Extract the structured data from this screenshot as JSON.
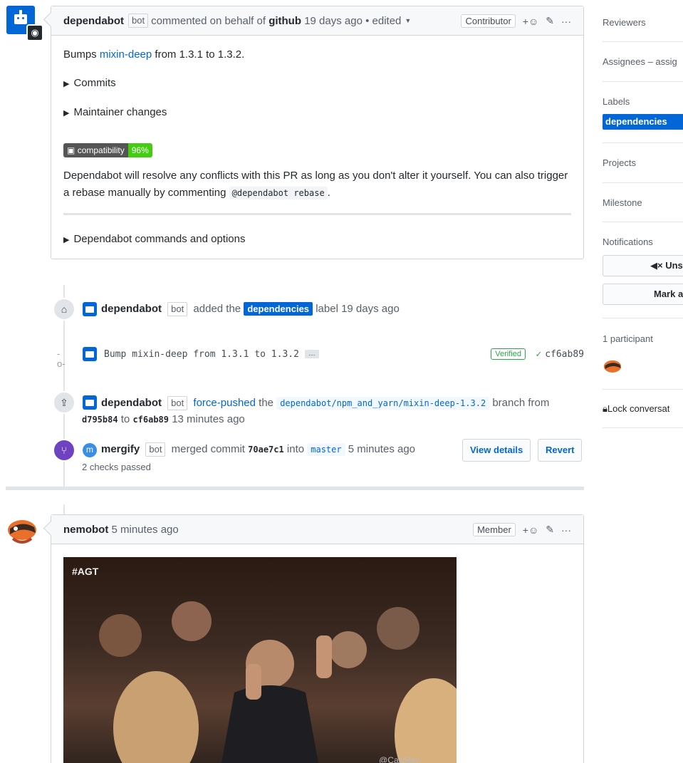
{
  "comment1": {
    "author": "dependabot",
    "bot_label": "bot",
    "meta": "commented on behalf of",
    "org": "github",
    "time": "19 days ago",
    "edited": "• edited",
    "role": "Contributor",
    "bumps_prefix": "Bumps ",
    "package": "mixin-deep",
    "bumps_suffix": " from 1.3.1 to 1.3.2.",
    "commits": "Commits",
    "maintainer": "Maintainer changes",
    "compat_label": "compatibility",
    "compat_value": "96%",
    "resolve_text": "Dependabot will resolve any conflicts with this PR as long as you don't alter it yourself. You can also trigger a rebase manually by commenting",
    "rebase_cmd": "@dependabot rebase",
    "period": ".",
    "commands": "Dependabot commands and options"
  },
  "label_event": {
    "author": "dependabot",
    "bot_label": "bot",
    "added": "added the",
    "label": "dependencies",
    "suffix": "label 19 days ago"
  },
  "commit": {
    "message": "Bump mixin-deep from 1.3.1 to 1.3.2",
    "ellipsis": "…",
    "verified": "Verified",
    "sha": "cf6ab89"
  },
  "push_event": {
    "author": "dependabot",
    "bot_label": "bot",
    "action": "force-pushed",
    "the": "the",
    "branch": "dependabot/npm_and_yarn/mixin-deep-1.3.2",
    "branch_from": "branch from",
    "from_sha": "d795b84",
    "to": "to",
    "to_sha": "cf6ab89",
    "time": "13 minutes ago"
  },
  "merge_event": {
    "author": "mergify",
    "bot_label": "bot",
    "merged": "merged commit",
    "sha": "70ae7c1",
    "into": "into",
    "branch": "master",
    "time": "5 minutes ago",
    "checks": "2 checks passed",
    "view_details": "View details",
    "revert": "Revert"
  },
  "comment2": {
    "author": "nemobot",
    "time": "5 minutes ago",
    "role": "Member",
    "gif_tag": "#AGT",
    "gif_credit": "@CalyBev"
  },
  "sidebar": {
    "reviewers": "Reviewers",
    "assignees": "Assignees – assig",
    "labels": "Labels",
    "label_dependencies": "dependencies",
    "projects": "Projects",
    "milestone": "Milestone",
    "notifications": "Notifications",
    "unsubscribe": "◀× Uns",
    "mark": "Mark a",
    "participants": "1 participant",
    "lock": "Lock conversat"
  },
  "colors": {
    "link": "#0366d6",
    "label_bg": "#0366d6",
    "merge_purple": "#6f42c1",
    "verified_green": "#28a745"
  }
}
